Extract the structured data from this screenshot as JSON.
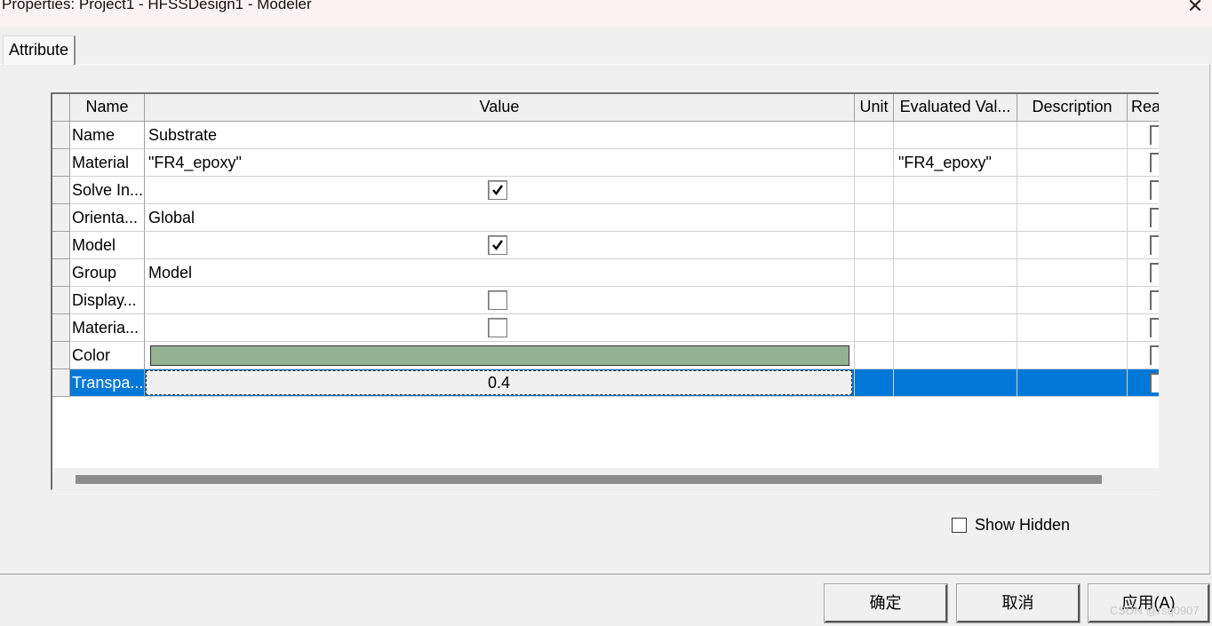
{
  "window": {
    "title": "Properties: Project1 - HFSSDesign1 - Modeler",
    "close_glyph": "✕"
  },
  "tabs": [
    {
      "label": "Attribute"
    }
  ],
  "grid": {
    "columns": [
      "Name",
      "Value",
      "Unit",
      "Evaluated Val...",
      "Description",
      "Rea"
    ],
    "rows": [
      {
        "name": "Name",
        "value": "Substrate",
        "evaluated": ""
      },
      {
        "name": "Material",
        "value": "\"FR4_epoxy\"",
        "evaluated": "\"FR4_epoxy\""
      },
      {
        "name": "Solve In...",
        "checked": true
      },
      {
        "name": "Orienta...",
        "value": "Global"
      },
      {
        "name": "Model",
        "checked": true
      },
      {
        "name": "Group",
        "value": "Model"
      },
      {
        "name": "Display...",
        "checked": false
      },
      {
        "name": "Materia...",
        "checked": false
      },
      {
        "name": "Color",
        "color": "#93b292"
      },
      {
        "name": "Transpa...",
        "value": "0.4",
        "selected": true
      }
    ]
  },
  "show_hidden": {
    "label": "Show Hidden",
    "checked": false
  },
  "buttons": {
    "ok": "确定",
    "cancel": "取消",
    "apply": "应用(A)"
  },
  "watermark": "CSDN @rsq0907",
  "colors": {
    "selection": "#0078d7",
    "color_swatch": "#93b292"
  }
}
